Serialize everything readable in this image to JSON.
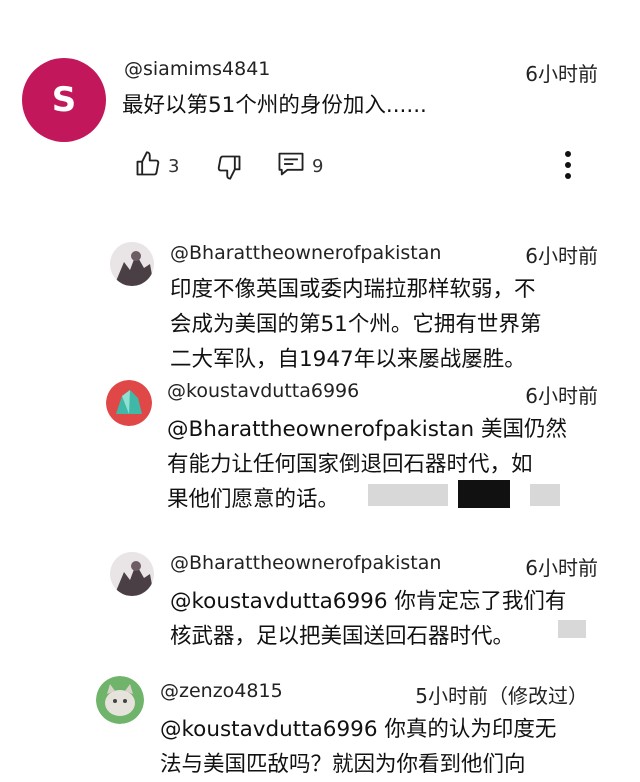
{
  "main_comment": {
    "avatar_letter": "S",
    "avatar_color": "#c2185b",
    "handle": "@siamims4841",
    "time": "6小时前",
    "text": "最好以第51个州的身份加入......",
    "likes": "3",
    "replies": "9"
  },
  "replies": [
    {
      "handle": "@Bharattheownerofpakistan",
      "time": "6小时前",
      "lines": [
        "印度不像英国或委内瑞拉那样软弱，不",
        "会成为美国的第51个州。它拥有世界第",
        "二大军队，自1947年以来屡战屡胜。"
      ]
    },
    {
      "handle": "@koustavdutta6996",
      "time": "6小时前",
      "lines": [
        "@Bharattheownerofpakistan 美国仍然",
        "有能力让任何国家倒退回石器时代，如",
        "果他们愿意的话。"
      ]
    },
    {
      "handle": "@Bharattheownerofpakistan",
      "time": "6小时前",
      "lines": [
        "@koustavdutta6996 你肯定忘了我们有",
        "核武器，足以把美国送回石器时代。"
      ]
    },
    {
      "handle": "@zenzo4815",
      "time": "5小时前（修改过）",
      "lines": [
        "@koustavdutta6996 你真的认为印度无",
        "法与美国匹敌吗？就因为你看到他们向"
      ]
    }
  ],
  "colors": {
    "accent": "#c2185b",
    "text": "#111111"
  },
  "icons": [
    "thumbs-up-icon",
    "thumbs-down-icon",
    "comment-icon",
    "more-vert-icon"
  ]
}
